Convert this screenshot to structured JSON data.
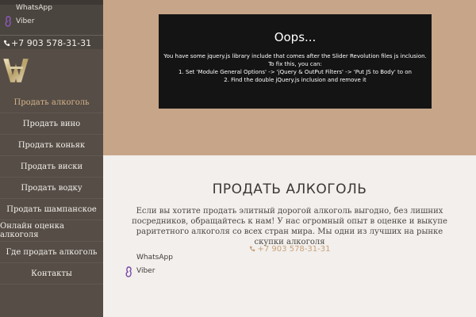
{
  "sidebar": {
    "whatsapp_label": "WhatsApp",
    "viber_label": "Viber",
    "phone": "+7 903 578-31-31",
    "phone_icon": "phone-icon",
    "menu": [
      {
        "label": "Продать алкоголь",
        "active": true
      },
      {
        "label": "Продать вино"
      },
      {
        "label": "Продать коньяк"
      },
      {
        "label": "Продать виски"
      },
      {
        "label": "Продать водку"
      },
      {
        "label": "Продать шампанское"
      },
      {
        "label": "Онлайн оценка алкоголя"
      },
      {
        "label": "Где продать алкоголь"
      },
      {
        "label": "Контакты"
      }
    ]
  },
  "error": {
    "heading": "Oops...",
    "lines": [
      "You have some jquery.js library include that comes after the Slider Revolution files js inclusion.",
      "To fix this, you can:",
      "1. Set 'Module General Options' -> 'jQuery & OutPut Filters' -> 'Put JS to Body' to on",
      "2. Find the double jQuery.js inclusion and remove it"
    ]
  },
  "content": {
    "title": "ПРОДАТЬ АЛКОГОЛЬ",
    "paragraph": "Если вы хотите продать элитный дорогой алкоголь выгодно, без лишних посредников, обращайтесь к нам! У нас огромный опыт в оценке и выкупе раритетного алкоголя со всех стран мира. Мы одни из лучших на рынке скупки алкоголя",
    "phone": "+7 903 578-31-31",
    "whatsapp_label": "WhatsApp",
    "viber_label": "Viber"
  },
  "colors": {
    "accent": "#c9a27a",
    "sidebar": "#554d46",
    "hero": "#c7a588"
  }
}
